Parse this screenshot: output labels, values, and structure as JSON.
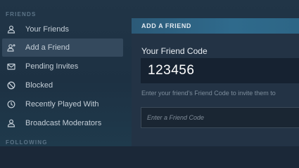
{
  "sidebar": {
    "friends_label": "FRIENDS",
    "following_label": "FOLLOWING",
    "items": [
      {
        "label": "Your Friends",
        "icon": "person-icon"
      },
      {
        "label": "Add a Friend",
        "icon": "add-person-icon"
      },
      {
        "label": "Pending Invites",
        "icon": "envelope-icon"
      },
      {
        "label": "Blocked",
        "icon": "blocked-icon"
      },
      {
        "label": "Recently Played With",
        "icon": "clock-icon"
      },
      {
        "label": "Broadcast Moderators",
        "icon": "person-icon"
      }
    ],
    "active_index": 1
  },
  "panel": {
    "header": "ADD A FRIEND",
    "code_label": "Your Friend Code",
    "code_value": "123456",
    "hint": "Enter your friend's Friend Code to invite them to",
    "input_placeholder": "Enter a Friend Code",
    "input_value": ""
  },
  "colors": {
    "background": "#1b2838",
    "header_accent": "#2f6a8c",
    "active_item": "#34495d",
    "text": "#c4ced7"
  }
}
